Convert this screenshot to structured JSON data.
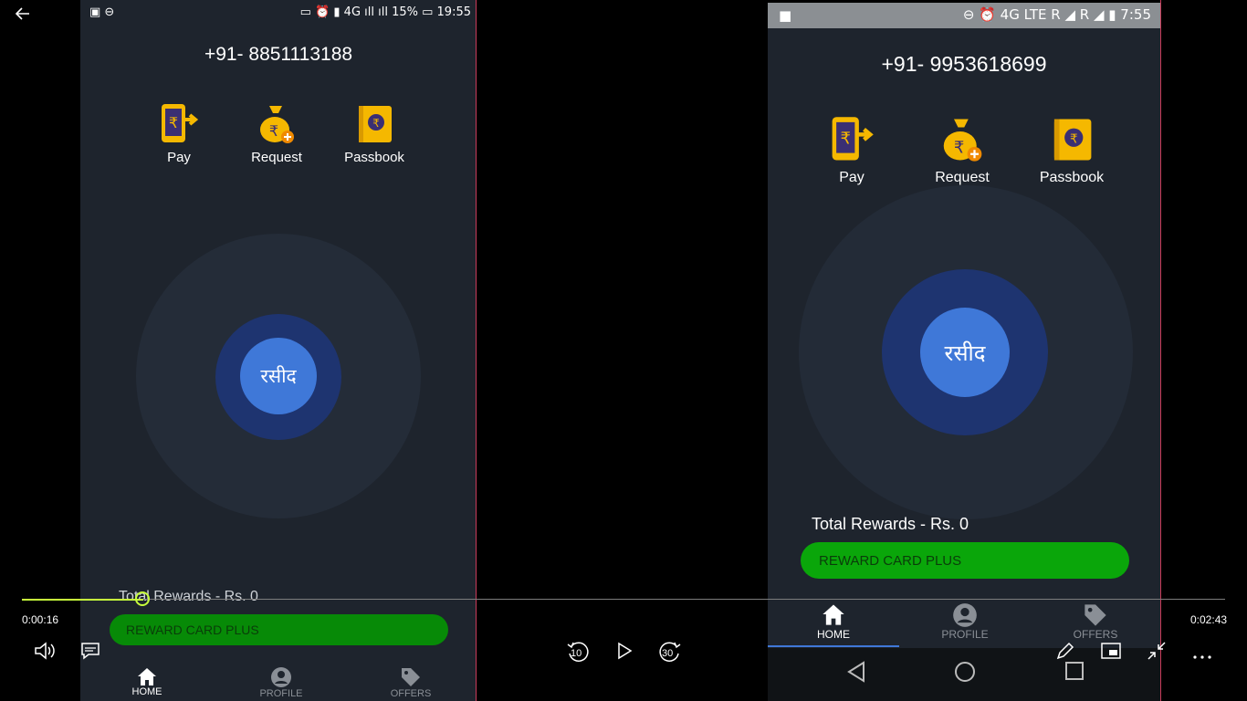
{
  "player": {
    "back_icon": "back-arrow-icon",
    "current_time": "0:00:16",
    "total_time": "0:02:43",
    "progress_fraction": 0.101,
    "skip_back_label": "10",
    "skip_forward_label": "30",
    "accent_color": "#c8ff3c"
  },
  "left_phone": {
    "status": {
      "left": "▣ ⊖",
      "right": "▭ ⏰ ▮ 4G ıll ıll 15% ▭ 19:55"
    },
    "phone_number": "+91- 8851113188",
    "actions": [
      {
        "label": "Pay",
        "icon": "pay-phone-rupee-icon"
      },
      {
        "label": "Request",
        "icon": "money-bag-icon"
      },
      {
        "label": "Passbook",
        "icon": "passbook-icon"
      }
    ],
    "center_button": "रसीद",
    "total_rewards": "Total Rewards - Rs. 0",
    "reward_button": "REWARD CARD PLUS",
    "nav": [
      {
        "label": "HOME",
        "icon": "home-icon"
      },
      {
        "label": "PROFILE",
        "icon": "profile-icon"
      },
      {
        "label": "OFFERS",
        "icon": "offers-tag-icon"
      }
    ]
  },
  "right_phone": {
    "status": {
      "left": "■",
      "right": "⊖ ⏰ 4G LTE R ◢ R ◢ ▮ 7:55"
    },
    "phone_number": "+91- 9953618699",
    "actions": [
      {
        "label": "Pay",
        "icon": "pay-phone-rupee-icon"
      },
      {
        "label": "Request",
        "icon": "money-bag-icon"
      },
      {
        "label": "Passbook",
        "icon": "passbook-icon"
      }
    ],
    "center_button": "रसीद",
    "total_rewards": "Total Rewards - Rs. 0",
    "reward_button": "REWARD CARD PLUS",
    "nav": [
      {
        "label": "HOME",
        "icon": "home-icon"
      },
      {
        "label": "PROFILE",
        "icon": "profile-icon"
      },
      {
        "label": "OFFERS",
        "icon": "offers-tag-icon"
      }
    ]
  }
}
